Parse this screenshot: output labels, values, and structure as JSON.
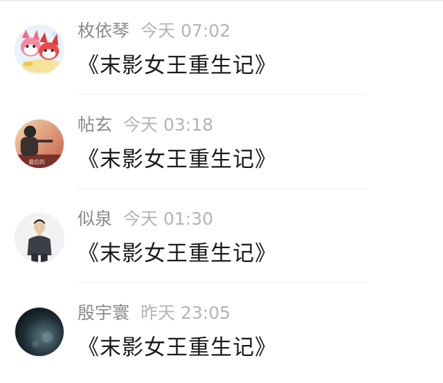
{
  "comments": [
    {
      "author": "枚依琴",
      "time": "今天 07:02",
      "text": "《末影女王重生记》",
      "avatar_icon": "cartoon-foxes-avatar"
    },
    {
      "author": "帖玄",
      "time": "今天 03:18",
      "text": "《末影女王重生记》",
      "avatar_icon": "person-sunset-avatar"
    },
    {
      "author": "似泉",
      "time": "今天 01:30",
      "text": "《末影女王重生记》",
      "avatar_icon": "person-sweater-avatar"
    },
    {
      "author": "殷宇寰",
      "time": "昨天 23:05",
      "text": "《末影女王重生记》",
      "avatar_icon": "dark-sky-avatar"
    }
  ],
  "avatar_overlay_text": "最后的"
}
